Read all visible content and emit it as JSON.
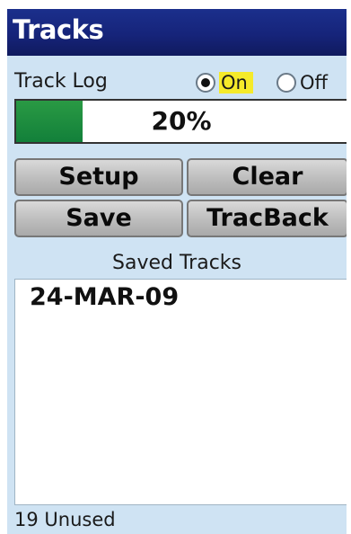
{
  "title": "Tracks",
  "track_log": {
    "label": "Track Log",
    "options": {
      "on": "On",
      "off": "Off"
    },
    "selected": "on"
  },
  "progress": {
    "value": 0.2,
    "label": "20%"
  },
  "buttons": {
    "setup": "Setup",
    "clear": "Clear",
    "save": "Save",
    "tracback": "TracBack"
  },
  "saved_tracks": {
    "label": "Saved Tracks",
    "items": [
      "24-MAR-09"
    ]
  },
  "status": "19 Unused",
  "colors": {
    "titlebar": "#16247a",
    "background": "#cfe3f3",
    "progress_fill": "#12803a",
    "on_highlight": "#f5ea2a"
  }
}
